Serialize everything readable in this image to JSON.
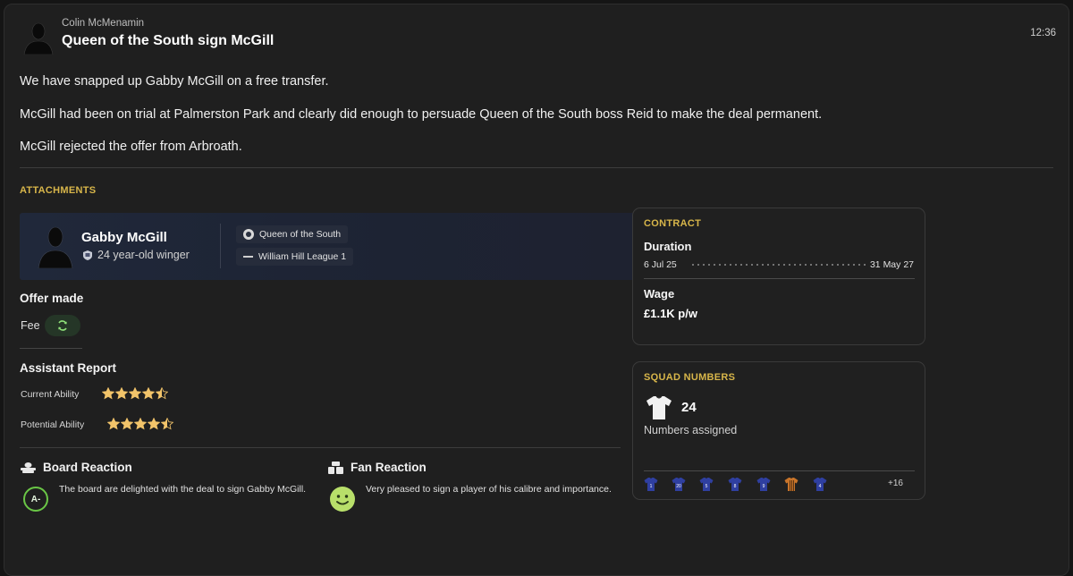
{
  "news": {
    "sender": "Colin McMenamin",
    "headline": "Queen of the South sign McGill",
    "time": "12:36",
    "paragraphs": [
      "We have snapped up Gabby McGill on a free transfer.",
      "McGill had been on trial at Palmerston Park and clearly did enough to persuade Queen of the South boss Reid to make the deal permanent.",
      "McGill rejected the offer from Arbroath."
    ]
  },
  "attachments_label": "ATTACHMENTS",
  "player": {
    "name": "Gabby McGill",
    "description": "24 year-old winger",
    "club": "Queen of the South",
    "league": "William Hill League 1"
  },
  "offer": {
    "title": "Offer made",
    "fee_label": "Fee",
    "fee_icon": "refresh-icon"
  },
  "report": {
    "title": "Assistant Report",
    "current_label": "Current Ability",
    "current_stars": 4.5,
    "potential_label": "Potential Ability",
    "potential_stars": 4.5,
    "star_color": "#f2c46a"
  },
  "board": {
    "title": "Board Reaction",
    "grade": "A-",
    "text": "The board are delighted with the deal to sign Gabby McGill.",
    "grade_color": "#6ac646"
  },
  "fans": {
    "title": "Fan Reaction",
    "text": "Very pleased to sign a player of his calibre and importance.",
    "mood_icon": "smiley-icon"
  },
  "contract": {
    "label": "CONTRACT",
    "duration_title": "Duration",
    "start": "6 Jul 25",
    "end": "31 May 27",
    "wage_title": "Wage",
    "wage": "£1.1K p/w"
  },
  "squad_numbers": {
    "label": "SQUAD NUMBERS",
    "number": "24",
    "subtitle": "Numbers assigned",
    "shirts": [
      {
        "number": "1",
        "type": "outfield"
      },
      {
        "number": "20",
        "type": "outfield"
      },
      {
        "number": "5",
        "type": "outfield"
      },
      {
        "number": "8",
        "type": "outfield"
      },
      {
        "number": "9",
        "type": "outfield"
      },
      {
        "number": "",
        "type": "keeper"
      },
      {
        "number": "4",
        "type": "outfield"
      }
    ],
    "more": "+16",
    "home_color": "#2f3fa0",
    "keeper_color": "#c8742a"
  }
}
